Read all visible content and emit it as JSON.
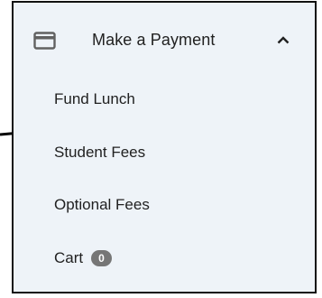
{
  "header": {
    "icon": "credit-card-icon",
    "title": "Make a Payment",
    "toggle_icon": "chevron-up-icon",
    "expanded": true
  },
  "menu": {
    "items": [
      {
        "label": "Fund Lunch"
      },
      {
        "label": "Student Fees"
      },
      {
        "label": "Optional Fees"
      },
      {
        "label": "Cart"
      }
    ],
    "cart_count": "0"
  },
  "annotation": {
    "icon": "pointer-arrow-icon",
    "color": "#000000"
  },
  "colors": {
    "panel_background": "#eef3f8",
    "border": "#111111",
    "text": "#212121",
    "icon": "#616161",
    "badge": "#767676"
  }
}
